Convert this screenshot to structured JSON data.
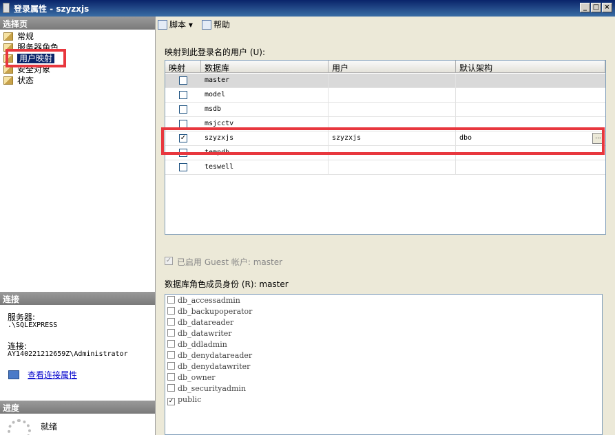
{
  "window": {
    "title": "登录属性 - szyzxjs",
    "min": "_",
    "max": "□",
    "close": "×"
  },
  "left": {
    "select_page_header": "选择页",
    "nav": [
      {
        "label": "常规",
        "icon": "page-icon"
      },
      {
        "label": "服务器角色",
        "icon": "page-icon"
      },
      {
        "label": "用户映射",
        "icon": "page-icon",
        "selected": true
      },
      {
        "label": "安全对象",
        "icon": "page-icon"
      },
      {
        "label": "状态",
        "icon": "page-icon"
      }
    ],
    "connection_header": "连接",
    "server_label": "服务器:",
    "server_value": ".\\SQLEXPRESS",
    "connection_label": "连接:",
    "connection_value": "AY140221212659Z\\Administrator",
    "view_props_link": "查看连接属性",
    "progress_header": "进度",
    "progress_status": "就绪"
  },
  "toolbar": {
    "script": "脚本",
    "script_arrow": "▾",
    "help": "帮助"
  },
  "mapping": {
    "label": "映射到此登录名的用户 (U):",
    "columns": [
      "映射",
      "数据库",
      "用户",
      "默认架构"
    ],
    "rows": [
      {
        "map": false,
        "db": "master",
        "user": "",
        "schema": ""
      },
      {
        "map": false,
        "db": "model",
        "user": "",
        "schema": ""
      },
      {
        "map": false,
        "db": "msdb",
        "user": "",
        "schema": ""
      },
      {
        "map": false,
        "db": "msjcctv",
        "user": "",
        "schema": ""
      },
      {
        "map": true,
        "db": "szyzxjs",
        "user": "szyzxjs",
        "schema": "dbo"
      },
      {
        "map": false,
        "db": "tempdb",
        "user": "",
        "schema": ""
      },
      {
        "map": false,
        "db": "teswell",
        "user": "",
        "schema": ""
      }
    ],
    "ellipsis": "..."
  },
  "guest": {
    "label": "已启用 Guest 帐户: master",
    "checked": true
  },
  "roles": {
    "label": "数据库角色成员身份 (R): master",
    "items": [
      {
        "name": "db_accessadmin",
        "checked": false
      },
      {
        "name": "db_backupoperator",
        "checked": false
      },
      {
        "name": "db_datareader",
        "checked": false
      },
      {
        "name": "db_datawriter",
        "checked": false
      },
      {
        "name": "db_ddladmin",
        "checked": false
      },
      {
        "name": "db_denydatareader",
        "checked": false
      },
      {
        "name": "db_denydatawriter",
        "checked": false
      },
      {
        "name": "db_owner",
        "checked": false
      },
      {
        "name": "db_securityadmin",
        "checked": false
      },
      {
        "name": "public",
        "checked": true
      }
    ]
  },
  "check_glyph": "✓",
  "colors": {
    "highlight": "#e8373e",
    "selection": "#0a246a"
  }
}
